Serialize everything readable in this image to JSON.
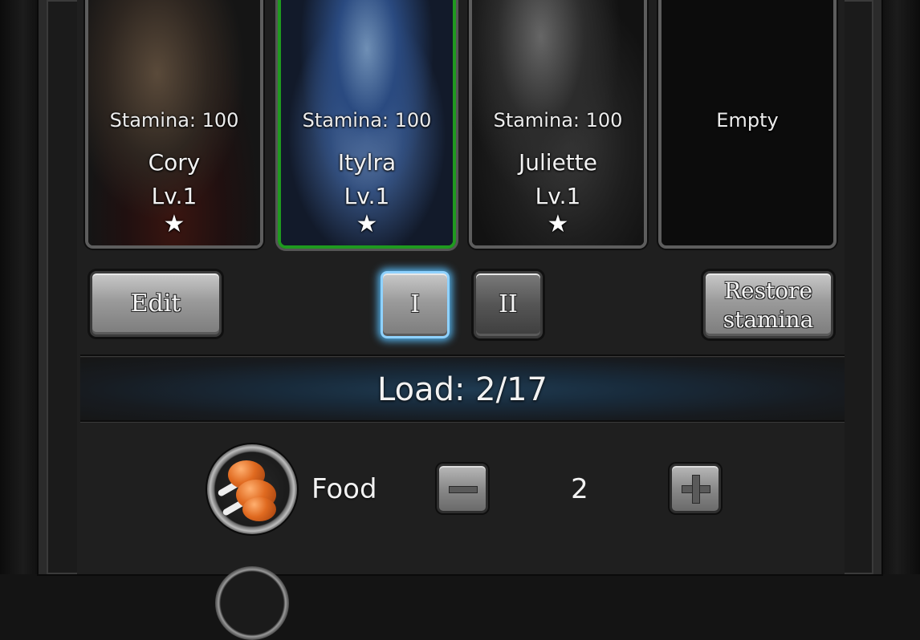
{
  "characters": [
    {
      "stamina": "Stamina: 100",
      "name": "Cory",
      "level": "Lv.1",
      "stars": "★",
      "selected": false
    },
    {
      "stamina": "Stamina: 100",
      "name": "Itylra",
      "level": "Lv.1",
      "stars": "★",
      "selected": true
    },
    {
      "stamina": "Stamina: 100",
      "name": "Juliette",
      "level": "Lv.1",
      "stars": "★",
      "selected": false
    },
    {
      "stamina": "Empty"
    }
  ],
  "buttons": {
    "edit": "Edit",
    "team_1": "I",
    "team_2": "II",
    "restore": "Restore stamina"
  },
  "load": "Load: 2/17",
  "items": [
    {
      "name": "Food",
      "quantity": "2",
      "icon": "food-meat-icon"
    }
  ],
  "colors": {
    "selected_border": "#1f9a1f",
    "active_team_glow": "#56b6f0"
  }
}
